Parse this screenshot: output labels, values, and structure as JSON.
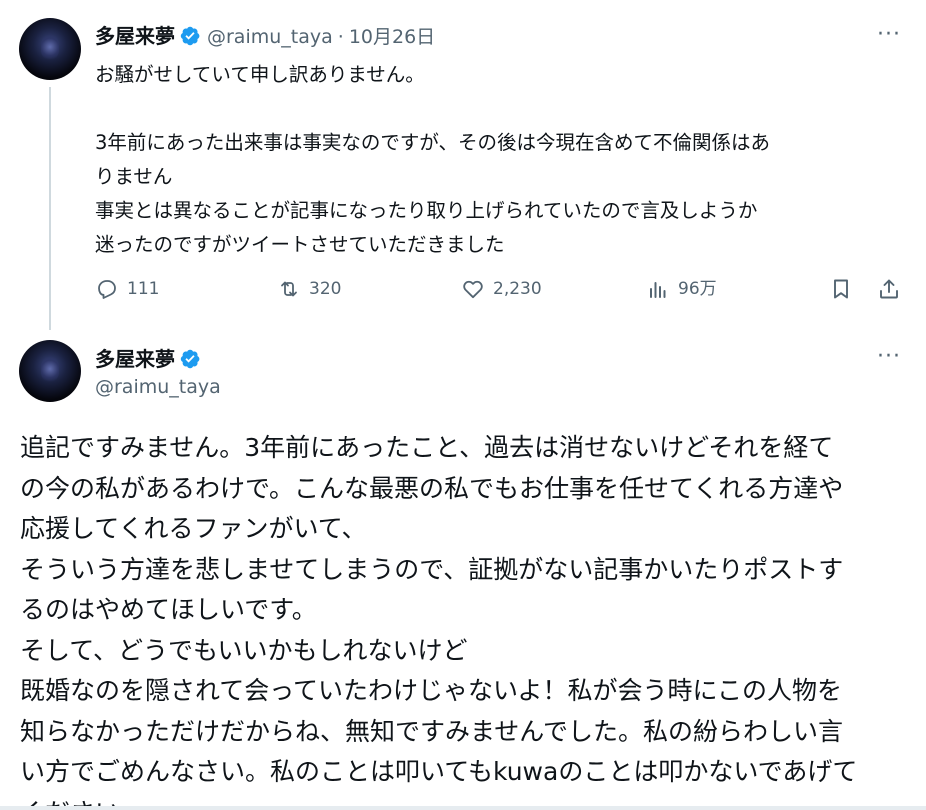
{
  "tweet1": {
    "display_name": "多屋来夢",
    "handle": "@raimu_taya",
    "date_separator": "·",
    "date": "10月26日",
    "more_label": "···",
    "body_lines": [
      "お騒がせしていて申し訳ありません。",
      "",
      "3年前にあった出来事は事実なのですが、その後は今現在含めて不倫関係はあ",
      "りません",
      "事実とは異なることが記事になったり取り上げられていたので言及しようか",
      "迷ったのですがツイートさせていただきました"
    ],
    "actions": {
      "reply_count": "111",
      "retweet_count": "320",
      "like_count": "2,230",
      "view_count": "96万"
    }
  },
  "tweet2": {
    "display_name": "多屋来夢",
    "handle": "@raimu_taya",
    "more_label": "···",
    "body_lines": [
      "追記ですみません。3年前にあったこと、過去は消せないけどそれを経て",
      "の今の私があるわけで。こんな最悪の私でもお仕事を任せてくれる方達や",
      "応援してくれるファンがいて、",
      "そういう方達を悲しませてしまうので、証拠がない記事かいたりポストす",
      "るのはやめてほしいです。",
      "そして、どうでもいいかもしれないけど",
      "既婚なのを隠されて会っていたわけじゃないよ！私が会う時にこの人物を",
      "知らなかっただけだからね、無知ですみませんでした。私の紛らわしい言",
      "い方でごめんなさい。私のことは叩いてもkuwaのことは叩かないであげて",
      "ください。"
    ]
  },
  "colors": {
    "verified_badge": "#1d9bf0",
    "secondary_text": "#536471",
    "primary_text": "#0f1419",
    "thread_line": "#cfd9de"
  },
  "icons": {
    "reply": "reply-icon",
    "retweet": "retweet-icon",
    "like": "heart-icon",
    "views": "views-icon",
    "bookmark": "bookmark-icon",
    "share": "share-icon",
    "verified": "verified-badge-icon"
  }
}
